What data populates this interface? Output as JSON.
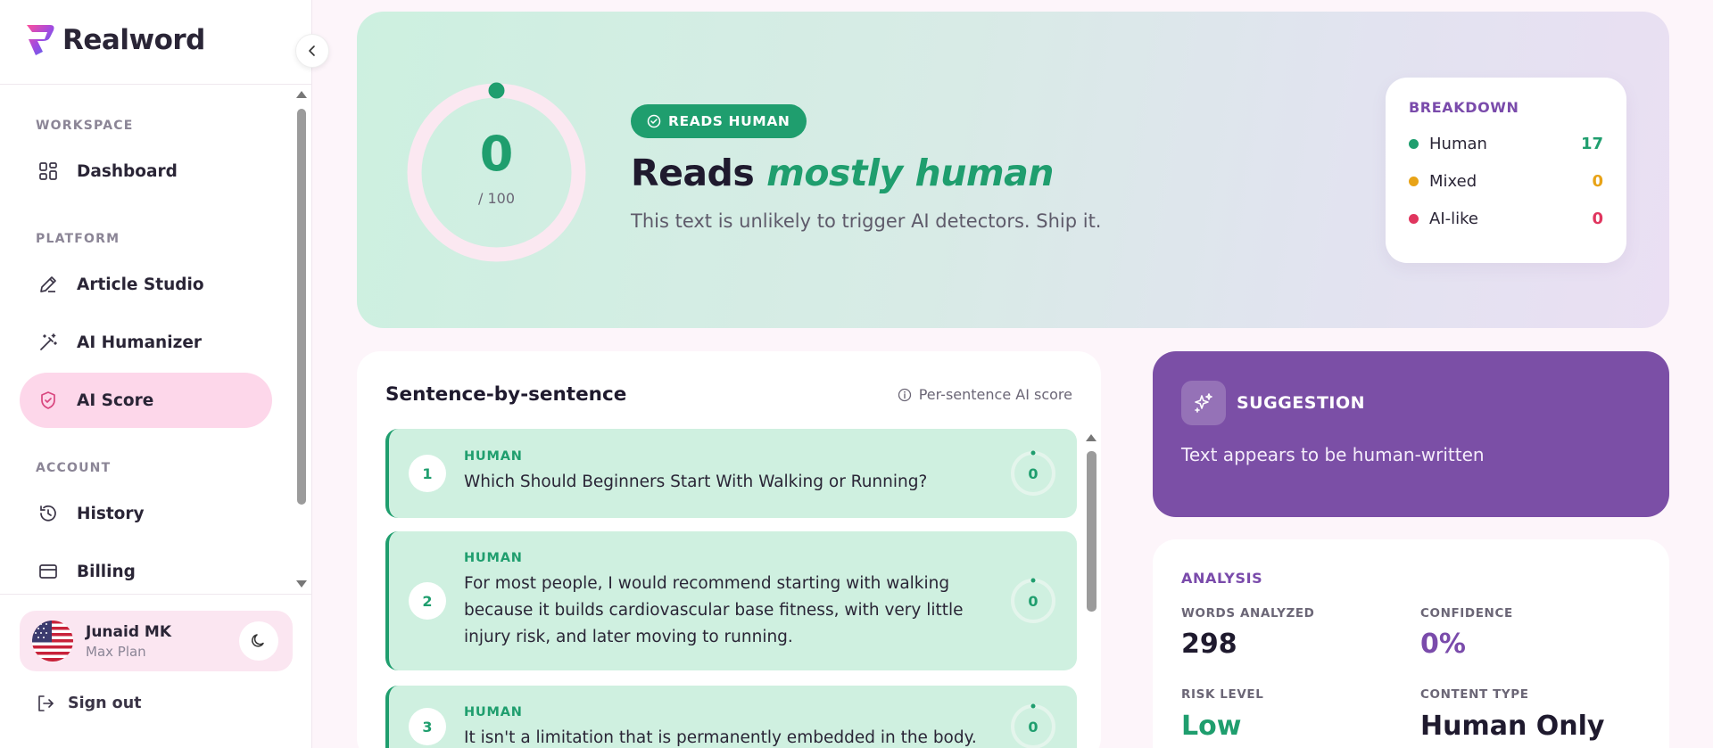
{
  "app": {
    "brand": "Realword"
  },
  "sidebar": {
    "sections": {
      "workspace": "WORKSPACE",
      "platform": "PLATFORM",
      "account": "ACCOUNT"
    },
    "items": [
      {
        "label": "Dashboard",
        "icon": "grid-icon"
      },
      {
        "label": "Article Studio",
        "icon": "pen-icon"
      },
      {
        "label": "AI Humanizer",
        "icon": "magic-wand-icon"
      },
      {
        "label": "AI Score",
        "icon": "shield-check-icon",
        "active": true
      },
      {
        "label": "History",
        "icon": "history-icon"
      },
      {
        "label": "Billing",
        "icon": "credit-card-icon"
      }
    ],
    "user": {
      "name": "Junaid MK",
      "plan": "Max Plan"
    },
    "signout": "Sign out"
  },
  "hero": {
    "score": "0",
    "score_max": "/ 100",
    "badge": "READS HUMAN",
    "headline_plain": "Reads",
    "headline_emphasis": "mostly human",
    "subtext": "This text is unlikely to trigger AI detectors. Ship it.",
    "breakdown": {
      "title": "BREAKDOWN",
      "rows": [
        {
          "label": "Human",
          "value": "17",
          "color": "#1f9e6e"
        },
        {
          "label": "Mixed",
          "value": "0",
          "color": "#e8a317"
        },
        {
          "label": "AI-like",
          "value": "0",
          "color": "#e0355e"
        }
      ]
    }
  },
  "sentences": {
    "title": "Sentence-by-sentence",
    "meta": "Per-sentence AI score",
    "items": [
      {
        "num": "1",
        "tag": "HUMAN",
        "text": "Which Should Beginners Start With Walking or Running?",
        "score": "0"
      },
      {
        "num": "2",
        "tag": "HUMAN",
        "text": "For most people, I would recommend starting with walking because it builds cardiovascular base fitness, with very little injury risk, and later moving to running.",
        "score": "0"
      },
      {
        "num": "3",
        "tag": "HUMAN",
        "text": "It isn't a limitation that is permanently embedded in the body.",
        "score": "0"
      }
    ]
  },
  "suggestion": {
    "title": "SUGGESTION",
    "text": "Text appears to be human-written"
  },
  "analysis": {
    "title": "ANALYSIS",
    "words_label": "WORDS ANALYZED",
    "words_value": "298",
    "confidence_label": "CONFIDENCE",
    "confidence_value": "0%",
    "risk_label": "RISK LEVEL",
    "risk_value": "Low",
    "content_label": "CONTENT TYPE",
    "content_value": "Human Only"
  },
  "colors": {
    "accent_green": "#1f9e6e",
    "accent_purple": "#7b4fa6",
    "active_pink": "#fdd7ea"
  }
}
